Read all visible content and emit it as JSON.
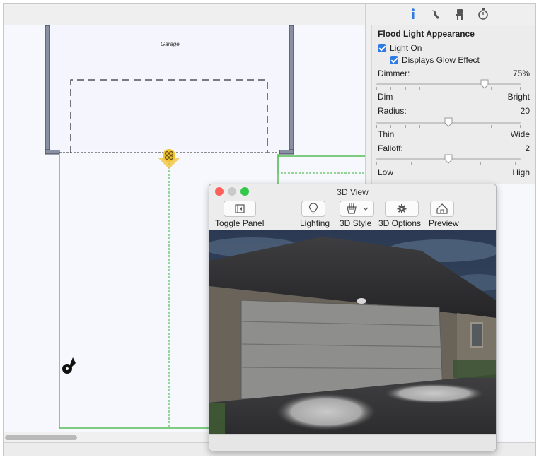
{
  "canvas": {
    "room_label": "Garage"
  },
  "panel": {
    "tabs": [
      "info-icon",
      "paint-brush-icon",
      "chair-icon",
      "stopwatch-icon"
    ],
    "title": "Flood Light Appearance",
    "light_on": {
      "label": "Light On",
      "checked": true
    },
    "glow": {
      "label": "Displays Glow Effect",
      "checked": true
    },
    "dimmer": {
      "label": "Dimmer:",
      "value": "75%",
      "level": 0.75,
      "min_label": "Dim",
      "max_label": "Bright"
    },
    "radius": {
      "label": "Radius:",
      "value": "20",
      "level": 0.5,
      "min_label": "Thin",
      "max_label": "Wide"
    },
    "falloff": {
      "label": "Falloff:",
      "value": "2",
      "level": 0.5,
      "min_label": "Low",
      "max_label": "High"
    }
  },
  "view3d": {
    "title": "3D View",
    "toolbar": {
      "toggle_panel": "Toggle Panel",
      "lighting": "Lighting",
      "style": "3D Style",
      "options": "3D Options",
      "preview": "Preview"
    },
    "colors": {
      "close": "#fc605b",
      "minimize": "#c9c9c9",
      "zoom": "#34c84a"
    }
  },
  "colors": {
    "accent": "#2e7be4",
    "wall": "#6a7186",
    "outline": "#36b236",
    "light_symbol": "#f1c232"
  }
}
